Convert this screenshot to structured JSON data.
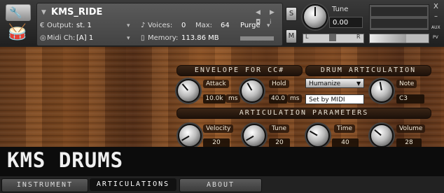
{
  "header": {
    "instrument_name": "KMS_RIDE",
    "output_label": "Output:",
    "output_value": "st. 1",
    "voices_label": "Voices:",
    "voices_value": "0",
    "max_label": "Max:",
    "max_value": "64",
    "purge_label": "Purge",
    "midi_label": "Midi Ch:",
    "midi_value": "[A]  1",
    "memory_label": "Memory:",
    "memory_value": "113.86 MB",
    "solo_label": "S",
    "mute_label": "M",
    "tune_label": "Tune",
    "tune_value": "0.00",
    "pan_left": "L",
    "pan_right": "R",
    "aux_label": "AUX",
    "pv_label": "PV",
    "close_label": "X",
    "minimize_label": "–"
  },
  "sections": {
    "envelope": "ENVELOPE FOR CC#",
    "drum_articulation": "DRUM ARTICULATION",
    "articulation_parameters": "ARTICULATION PARAMETERS"
  },
  "envelope": {
    "attack_label": "Attack",
    "attack_value": "10.0k",
    "attack_unit": "ms",
    "hold_label": "Hold",
    "hold_value": "40.0",
    "hold_unit": "ms"
  },
  "drum": {
    "mode_value": "Humanize",
    "set_midi_label": "Set by MIDI",
    "note_label": "Note",
    "note_value": "C3"
  },
  "params": {
    "velocity_label": "Velocity",
    "velocity_value": "20",
    "tune_label": "Tune",
    "tune_value": "20",
    "time_label": "Time",
    "time_value": "40",
    "volume_label": "Volume",
    "volume_value": "28"
  },
  "banner": {
    "title": "KMS DRUMS"
  },
  "tabs": [
    {
      "label": "INSTRUMENT",
      "active": false
    },
    {
      "label": "ARTICULATIONS",
      "active": true
    },
    {
      "label": "ABOUT",
      "active": false
    }
  ],
  "icons": {
    "wrench": "wrench-icon",
    "logo": "drum-logo-icon",
    "output": "output-icon",
    "midi": "midi-icon",
    "voices": "voices-icon",
    "memory": "memory-icon"
  }
}
